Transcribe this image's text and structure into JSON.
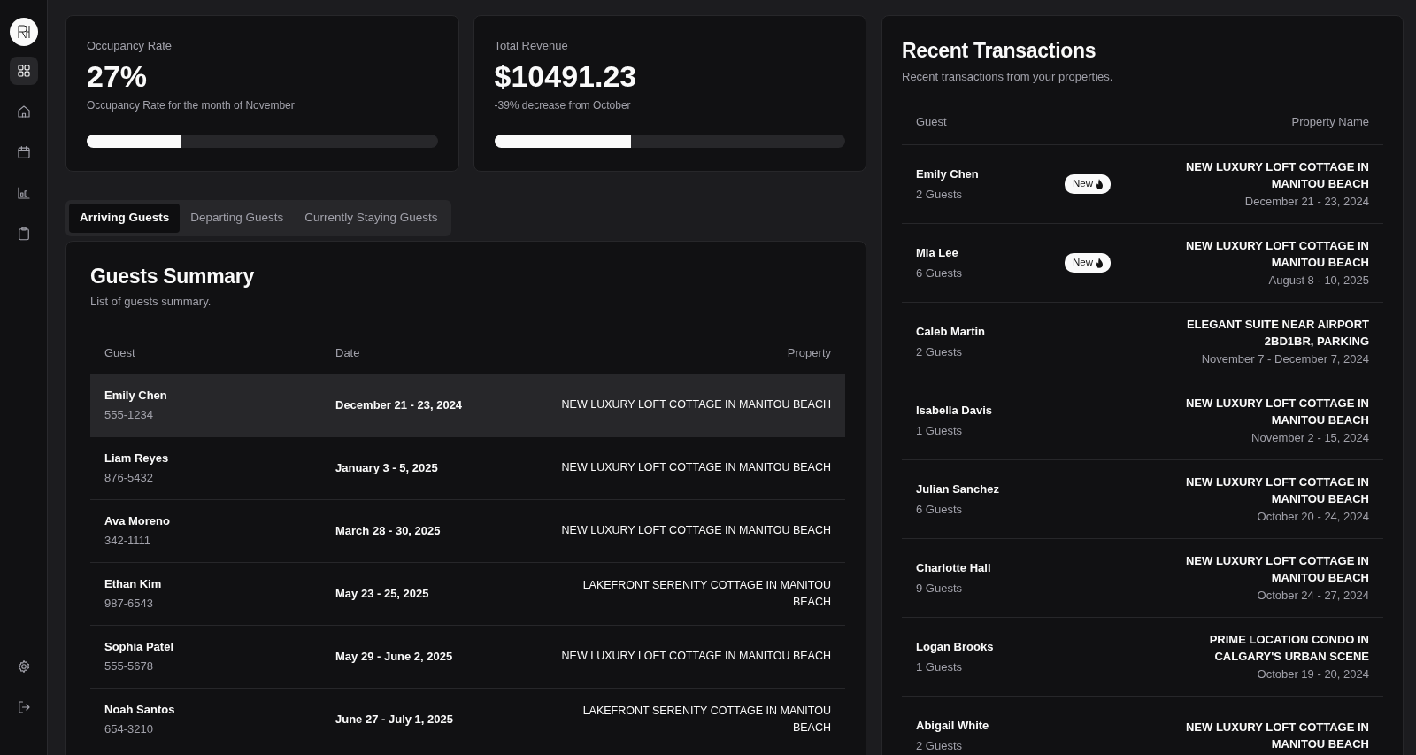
{
  "sidebar": {
    "items": [
      {
        "selected": true
      },
      {
        "selected": false
      },
      {
        "selected": false
      },
      {
        "selected": false
      },
      {
        "selected": false
      }
    ],
    "bottom_items": [
      {
        "selected": false
      },
      {
        "selected": false
      }
    ]
  },
  "stats": [
    {
      "label": "Occupancy Rate",
      "value": "27%",
      "caption": "Occupancy Rate for the month of November",
      "level": 0.27
    },
    {
      "label": "Total Revenue",
      "value": "$10491.23",
      "caption": "-39% decrease from October",
      "level": 0.39
    }
  ],
  "tabs": [
    {
      "label": "Arriving Guests",
      "selected": true
    },
    {
      "label": "Departing Guests",
      "selected": false
    },
    {
      "label": "Currently Staying Guests",
      "selected": false
    }
  ],
  "guests_summary": {
    "title": "Guests Summary",
    "subtitle": "List of guests summary.",
    "columns": [
      "Guest",
      "Date",
      "Property"
    ],
    "rows": [
      {
        "name": "Emily Chen",
        "phone": "555-1234",
        "date": "December 21 - 23, 2024",
        "property": "NEW LUXURY LOFT COTTAGE IN MANITOU BEACH",
        "selected": true
      },
      {
        "name": "Liam Reyes",
        "phone": "876-5432",
        "date": "January 3 - 5, 2025",
        "property": "NEW LUXURY LOFT COTTAGE IN MANITOU BEACH",
        "selected": false
      },
      {
        "name": "Ava Moreno",
        "phone": "342-1111",
        "date": "March 28 - 30, 2025",
        "property": "NEW LUXURY LOFT COTTAGE IN MANITOU BEACH",
        "selected": false
      },
      {
        "name": "Ethan Kim",
        "phone": "987-6543",
        "date": "May 23 - 25, 2025",
        "property": "LAKEFRONT SERENITY COTTAGE IN MANITOU BEACH",
        "selected": false
      },
      {
        "name": "Sophia Patel",
        "phone": "555-5678",
        "date": "May 29 - June 2, 2025",
        "property": "NEW LUXURY LOFT COTTAGE IN MANITOU BEACH",
        "selected": false
      },
      {
        "name": "Noah Santos",
        "phone": "654-3210",
        "date": "June 27 - July 1, 2025",
        "property": "LAKEFRONT SERENITY COTTAGE IN MANITOU BEACH",
        "selected": false
      }
    ]
  },
  "recent_transactions": {
    "title": "Recent Transactions",
    "subtitle": "Recent transactions from your properties.",
    "columns": [
      "Guest",
      "Property Name"
    ],
    "rows": [
      {
        "name": "Emily Chen",
        "guests": "2 Guests",
        "badge": "New",
        "property": "NEW LUXURY LOFT COTTAGE IN MANITOU BEACH",
        "dates": "December 21 - 23, 2024"
      },
      {
        "name": "Mia Lee",
        "guests": "6 Guests",
        "badge": "New",
        "property": "NEW LUXURY LOFT COTTAGE IN MANITOU BEACH",
        "dates": "August 8 - 10, 2025"
      },
      {
        "name": "Caleb Martin",
        "guests": "2 Guests",
        "property": "ELEGANT SUITE NEAR AIRPORT 2BD1BR, PARKING",
        "dates": "November 7 - December 7, 2024"
      },
      {
        "name": "Isabella Davis",
        "guests": "1 Guests",
        "property": "NEW LUXURY LOFT COTTAGE IN MANITOU BEACH",
        "dates": "November 2 - 15, 2024"
      },
      {
        "name": "Julian Sanchez",
        "guests": "6 Guests",
        "property": "NEW LUXURY LOFT COTTAGE IN MANITOU BEACH",
        "dates": "October 20 - 24, 2024"
      },
      {
        "name": "Charlotte Hall",
        "guests": "9 Guests",
        "property": "NEW LUXURY LOFT COTTAGE IN MANITOU BEACH",
        "dates": "October 24 - 27, 2024"
      },
      {
        "name": "Logan Brooks",
        "guests": "1 Guests",
        "property": "PRIME LOCATION CONDO IN CALGARY'S URBAN SCENE",
        "dates": "October 19 - 20, 2024"
      },
      {
        "name": "Abigail White",
        "guests": "2 Guests",
        "property": "NEW LUXURY LOFT COTTAGE IN MANITOU BEACH"
      }
    ]
  }
}
